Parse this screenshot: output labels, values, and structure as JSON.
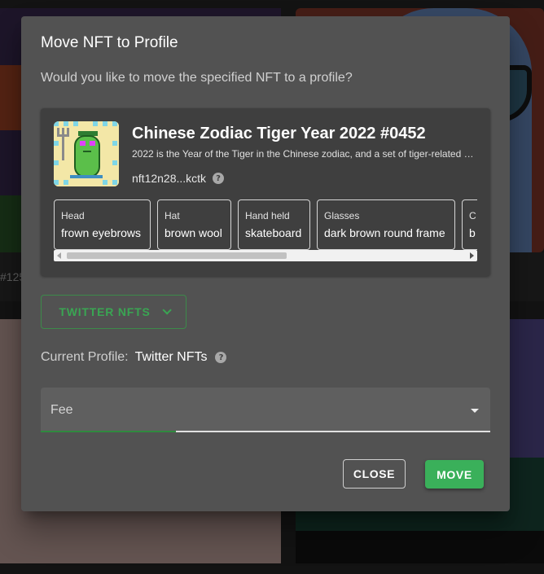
{
  "background": {
    "card_caption_partial": "#125"
  },
  "dialog": {
    "title": "Move NFT to Profile",
    "subtitle": "Would you like to move the specified NFT to a profile?",
    "nft": {
      "name": "Chinese Zodiac Tiger Year 2022 #0452",
      "description": "2022 is the Year of the Tiger in the Chinese zodiac, and a set of tiger-related NFTs …",
      "id_short": "nft12n28...kctk",
      "attributes": [
        {
          "key": "Head",
          "value": "frown eyebrows"
        },
        {
          "key": "Hat",
          "value": "brown wool"
        },
        {
          "key": "Hand held",
          "value": "skateboard"
        },
        {
          "key": "Glasses",
          "value": "dark brown round frame"
        },
        {
          "key": "C",
          "value": "b"
        }
      ]
    },
    "profile_select": {
      "label": "TWITTER NFTS",
      "icon": "chevron-down-icon"
    },
    "current_profile": {
      "label": "Current Profile:",
      "value": "Twitter NFTs",
      "icon": "help-icon"
    },
    "fee": {
      "label": "Fee",
      "icon": "dropdown-caret-icon",
      "progress_percent": 30
    },
    "actions": {
      "close_label": "CLOSE",
      "move_label": "MOVE"
    }
  },
  "colors": {
    "accent": "#3ab05a",
    "dialog_bg": "#525252",
    "card_bg": "#3f3f3f"
  }
}
